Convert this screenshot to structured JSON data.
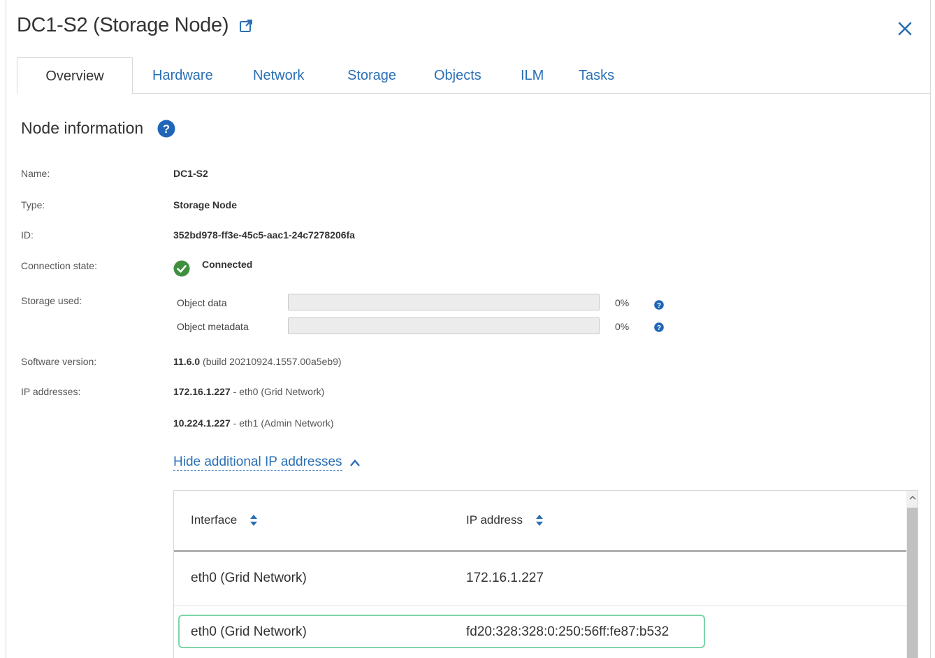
{
  "header": {
    "title": "DC1-S2 (Storage Node)"
  },
  "tabs": [
    {
      "label": "Overview"
    },
    {
      "label": "Hardware"
    },
    {
      "label": "Network"
    },
    {
      "label": "Storage"
    },
    {
      "label": "Objects"
    },
    {
      "label": "ILM"
    },
    {
      "label": "Tasks"
    }
  ],
  "section": {
    "title": "Node information"
  },
  "info": {
    "name_label": "Name:",
    "name_value": "DC1-S2",
    "type_label": "Type:",
    "type_value": "Storage Node",
    "id_label": "ID:",
    "id_value": "352bd978-ff3e-45c5-aac1-24c7278206fa",
    "conn_label": "Connection state:",
    "conn_value": "Connected",
    "storage_label": "Storage used:",
    "storage": [
      {
        "label": "Object data",
        "percent_text": "0%",
        "percent": 0
      },
      {
        "label": "Object metadata",
        "percent_text": "0%",
        "percent": 0
      }
    ],
    "software_label": "Software version:",
    "software_version": "11.6.0",
    "software_build": "(build 20210924.1557.00a5eb9)",
    "ip_label": "IP addresses:",
    "ips": [
      {
        "address": "172.16.1.227",
        "desc": "- eth0 (Grid Network)"
      },
      {
        "address": "10.224.1.227",
        "desc": "- eth1 (Admin Network)"
      }
    ]
  },
  "toggle_label": "Hide additional IP addresses",
  "table": {
    "columns": [
      "Interface",
      "IP address"
    ],
    "rows": [
      {
        "interface": "eth0 (Grid Network)",
        "ip": "172.16.1.227"
      },
      {
        "interface": "eth0 (Grid Network)",
        "ip": "fd20:328:328:0:250:56ff:fe87:b532"
      }
    ]
  },
  "colors": {
    "link": "#2a6fb5",
    "success": "#3f8f3f",
    "highlight_border": "#7fd4a8"
  },
  "icons": [
    "external-link-icon",
    "close-icon",
    "help-icon",
    "check-circle-icon",
    "chevron-up-icon",
    "sort-icon"
  ]
}
